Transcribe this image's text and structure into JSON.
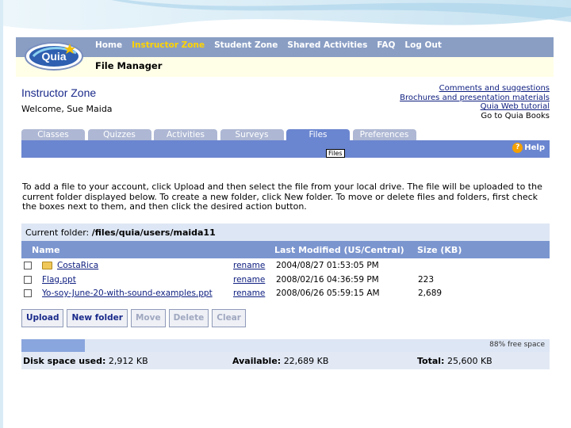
{
  "nav": {
    "items": [
      "Home",
      "Instructor Zone",
      "Student Zone",
      "Shared Activities",
      "FAQ",
      "Log Out"
    ],
    "active_index": 1
  },
  "logo_text": "Quia",
  "page_title": "File Manager",
  "zone_title": "Instructor Zone",
  "welcome": "Welcome, Sue Maida",
  "right_links": [
    "Comments and suggestions",
    "Brochures and presentation materials",
    "Quia Web tutorial",
    "Go to Quia Books"
  ],
  "tabs": [
    "Classes",
    "Quizzes",
    "Activities",
    "Surveys",
    "Files",
    "Preferences"
  ],
  "active_tab": "Files",
  "help_label": "Help",
  "tooltip": "Files",
  "instructions": "To add a file to your account, click Upload and then select the file from your local drive. The file will be uploaded to the current folder displayed below. To create a new folder, click New folder. To move or delete files and folders, first check the boxes next to them, and then click the desired action button.",
  "current_folder": {
    "label": "Current folder:",
    "path": "/files/quia/users/maida11"
  },
  "table": {
    "headers": [
      "Name",
      "Last Modified (US/Central)",
      "Size (KB)"
    ],
    "rows": [
      {
        "name": "CostaRica",
        "is_folder": true,
        "action": "rename",
        "modified": "2004/08/27 01:53:05 PM",
        "size": ""
      },
      {
        "name": "Flag.ppt",
        "is_folder": false,
        "action": "rename",
        "modified": "2008/02/16 04:36:59 PM",
        "size": "223"
      },
      {
        "name": "Yo-soy-June-20-with-sound-examples.ppt",
        "is_folder": false,
        "action": "rename",
        "modified": "2008/06/26 05:59:15 AM",
        "size": "2,689"
      }
    ]
  },
  "buttons": {
    "upload": "Upload",
    "new_folder": "New folder",
    "move": "Move",
    "delete": "Delete",
    "clear": "Clear"
  },
  "disk": {
    "used_fraction": 0.12,
    "free_label": "88% free space",
    "used_label": "Disk space used:",
    "used_value": "2,912 KB",
    "available_label": "Available:",
    "available_value": "22,689 KB",
    "total_label": "Total:",
    "total_value": "25,600 KB"
  },
  "colors": {
    "topbar": "#8a9ec4",
    "tab_active": "#6b86d0",
    "nav_active": "#ffd400"
  }
}
